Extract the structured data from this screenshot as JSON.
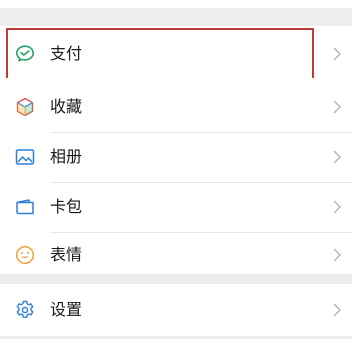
{
  "colors": {
    "background": "#ededed",
    "card": "#ffffff",
    "highlight_border": "#c0393b",
    "pay_icon": "#22a164",
    "album_icon": "#2f7fd6",
    "cards_icon": "#2f7fd6",
    "sticker_icon": "#e9a33b",
    "settings_icon": "#2f7fd6"
  },
  "menu": {
    "pay": {
      "label": "支付",
      "icon": "pay-icon"
    },
    "favorites": {
      "label": "收藏",
      "icon": "cube-icon"
    },
    "album": {
      "label": "相册",
      "icon": "image-icon"
    },
    "cards": {
      "label": "卡包",
      "icon": "card-icon"
    },
    "stickers": {
      "label": "表情",
      "icon": "smiley-icon"
    },
    "settings": {
      "label": "设置",
      "icon": "gear-icon"
    }
  }
}
